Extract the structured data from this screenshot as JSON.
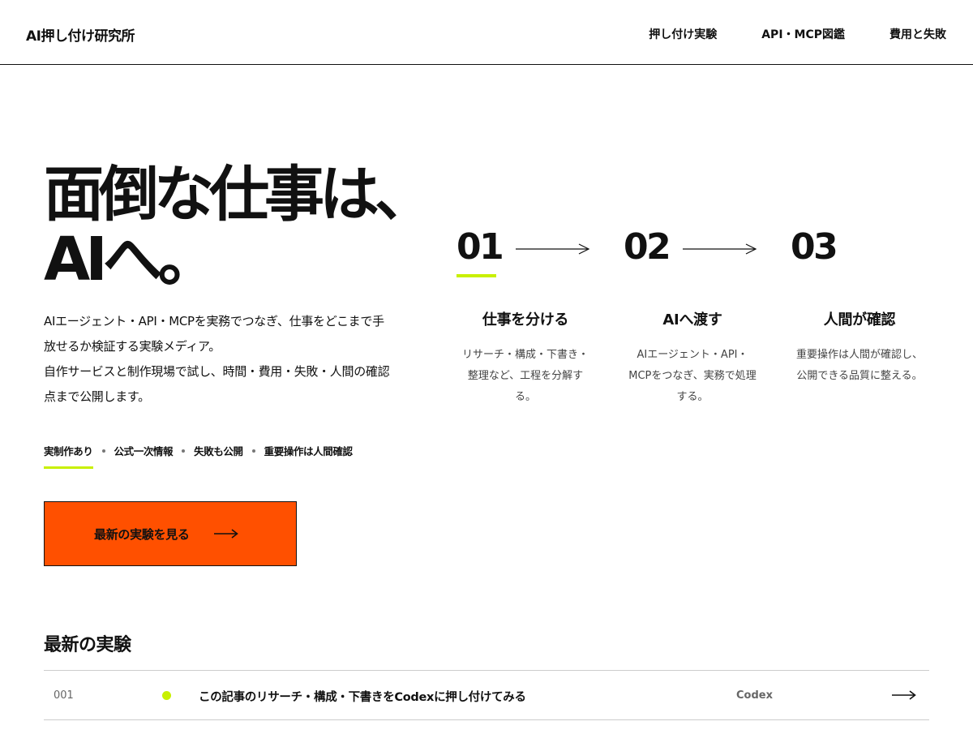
{
  "header": {
    "logo": "AI押し付け研究所",
    "nav": [
      "押し付け実験",
      "API・MCP図鑑",
      "費用と失敗"
    ]
  },
  "hero": {
    "title_lines": [
      "面倒な仕事は、",
      "AIへ。"
    ],
    "lead_lines": [
      "AIエージェント・API・MCPを実務でつなぎ、仕事をどこまで手",
      "放せるか検証する実験メディア。",
      "自作サービスと制作現場で試し、時間・費用・失敗・人間の確認",
      "点まで公開します。"
    ],
    "tags": [
      "実制作あり",
      "公式一次情報",
      "失敗も公開",
      "重要操作は人間確認"
    ],
    "active_tag_index": 0,
    "cta_label": "最新の実験を見る",
    "cta_arrow_icon": "long-arrow-right-icon"
  },
  "steps": [
    {
      "num": "01",
      "title": "仕事を分ける",
      "desc_lines": [
        "リサーチ・構成・下書き・",
        "整理など、工程を分解す",
        "る。"
      ]
    },
    {
      "num": "02",
      "title": "AIへ渡す",
      "desc_lines": [
        "AIエージェント・API・",
        "MCPをつなぎ、実務で処理",
        "する。"
      ]
    },
    {
      "num": "03",
      "title": "人間が確認",
      "desc_lines": [
        "重要操作は人間が確認し、",
        "公開できる品質に整える。"
      ]
    }
  ],
  "latest": {
    "heading": "最新の実験",
    "items": [
      {
        "num": "001",
        "title": "この記事のリサーチ・構成・下書きをCodexに押し付けてみる",
        "tool": "Codex"
      }
    ]
  },
  "colors": {
    "accent": "#ff5000",
    "highlight": "#c8f000",
    "text": "#111111",
    "rule": "#cccccc"
  }
}
